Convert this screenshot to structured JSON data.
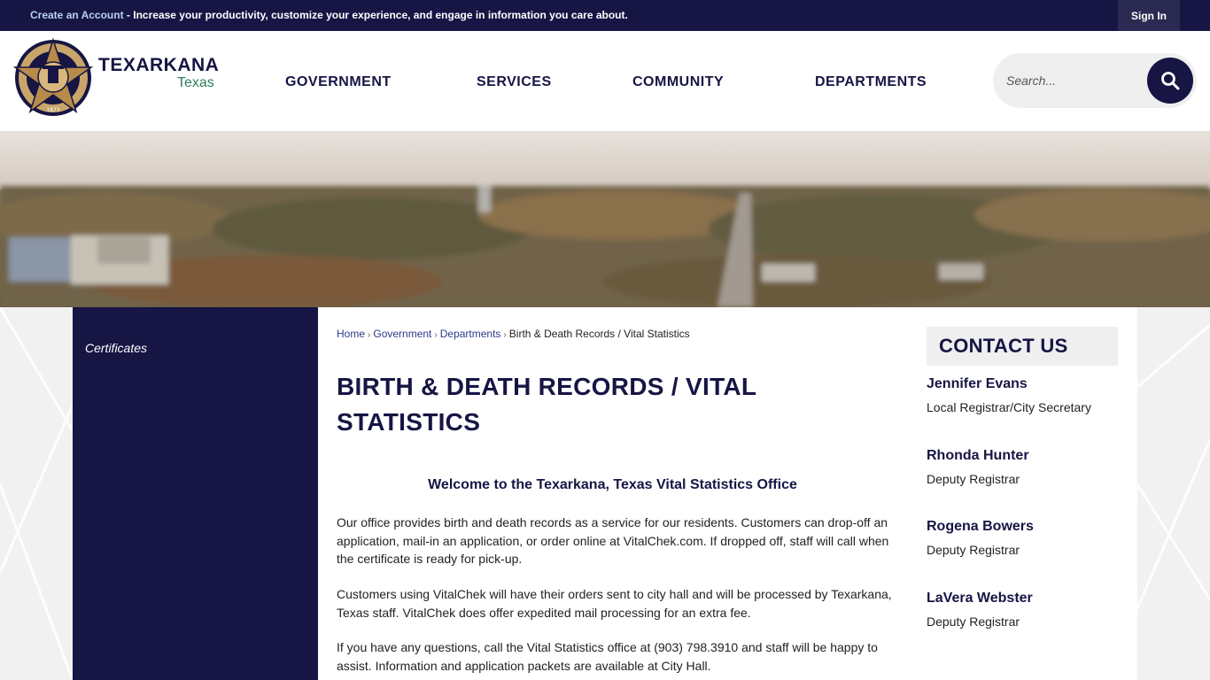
{
  "topbar": {
    "create_link": "Create an Account",
    "message": " - Increase your productivity, customize your experience, and engage in information you care about.",
    "signin_label": "Sign In"
  },
  "header": {
    "brand_name": "TEXARKANA",
    "brand_sub": "Texas",
    "logo_text": "CITY OF TEXARKANA",
    "logo_year": "1873",
    "nav": [
      "GOVERNMENT",
      "SERVICES",
      "COMMUNITY",
      "DEPARTMENTS"
    ],
    "search_placeholder": "Search..."
  },
  "sidebar": {
    "items": [
      {
        "label": "Certificates"
      }
    ]
  },
  "breadcrumb": [
    "Home",
    "Government",
    "Departments",
    "Birth & Death Records / Vital Statistics"
  ],
  "main": {
    "title": "BIRTH & DEATH RECORDS / VITAL STATISTICS",
    "welcome": "Welcome to the Texarkana, Texas Vital Statistics Office",
    "paragraphs": [
      "Our office provides birth and death records as a service for our residents. Customers can drop-off an application, mail-in an application, or order online at VitalChek.com. If dropped off, staff will call when the certificate is ready for pick-up.",
      "Customers using VitalChek will have their orders sent to city hall and will be processed by Texarkana, Texas staff. VitalChek does offer expedited mail processing for an extra fee.",
      "If you have any questions, call the Vital Statistics office at (903) 798.3910 and staff will be happy to assist. Information and application packets are available at City Hall."
    ]
  },
  "contact": {
    "heading": "CONTACT US",
    "people": [
      {
        "name": "Jennifer Evans",
        "role": "Local Registrar/City Secretary"
      },
      {
        "name": "Rhonda Hunter",
        "role": "Deputy Registrar"
      },
      {
        "name": "Rogena Bowers",
        "role": "Deputy Registrar"
      },
      {
        "name": "LaVera Webster",
        "role": "Deputy Registrar"
      }
    ]
  },
  "colors": {
    "navy": "#161544",
    "accent_green": "#2e7d5b",
    "link_blue": "#2c3a8a",
    "panel_gray": "#efefef"
  }
}
